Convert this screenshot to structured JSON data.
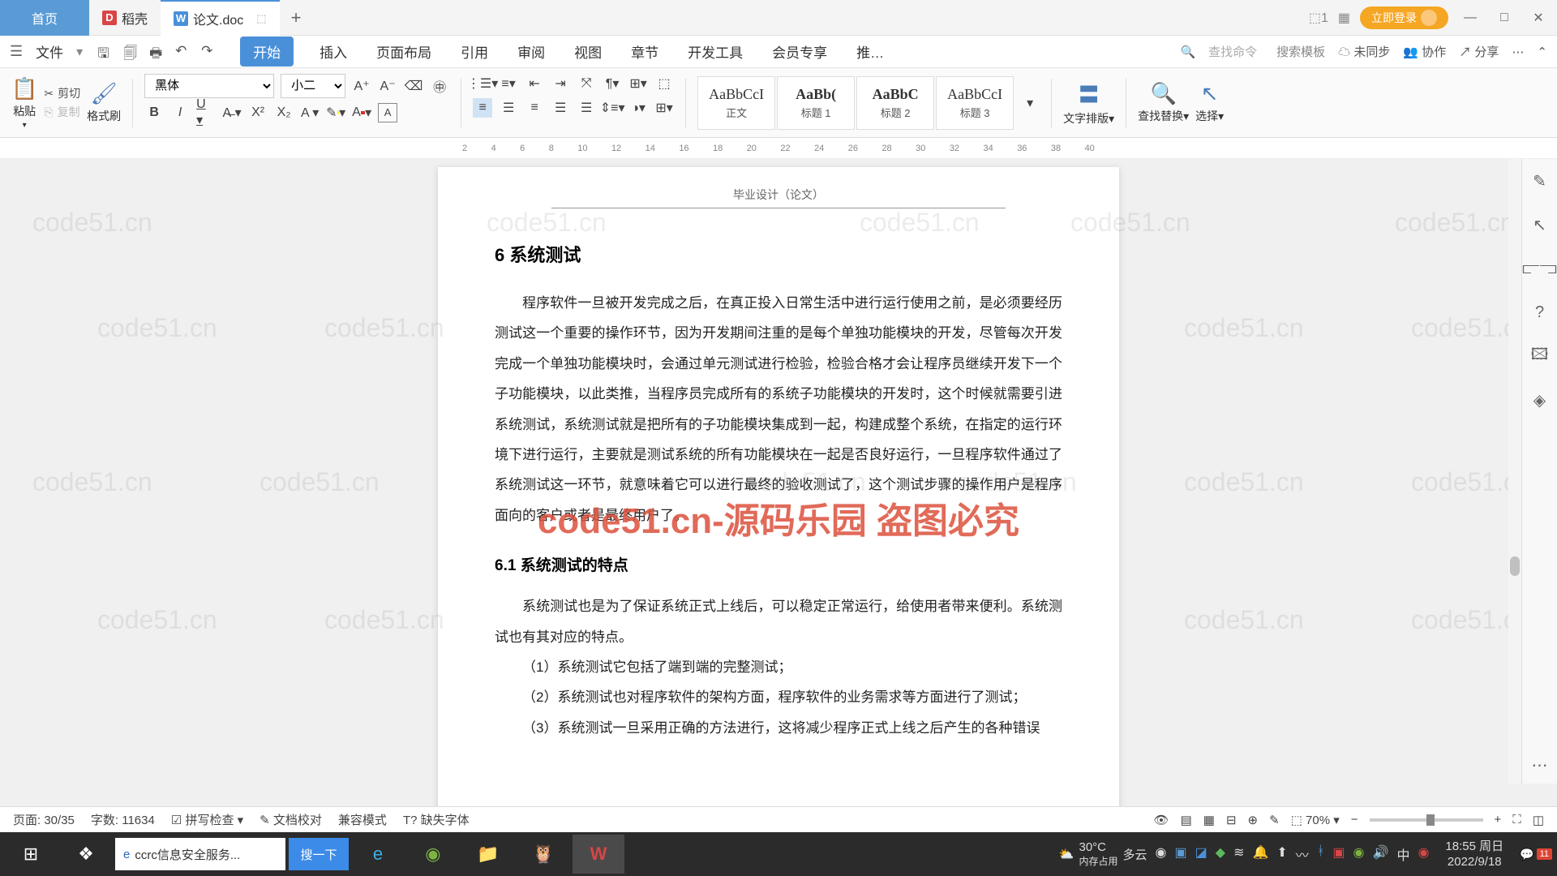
{
  "titlebar": {
    "tabs": [
      {
        "label": "首页",
        "icon": ""
      },
      {
        "label": "稻壳",
        "icon": "D"
      },
      {
        "label": "论文.doc",
        "icon": "W"
      }
    ],
    "login": "立即登录"
  },
  "menubar": {
    "file": "文件",
    "tabs": [
      "开始",
      "插入",
      "页面布局",
      "引用",
      "审阅",
      "视图",
      "章节",
      "开发工具",
      "会员专享",
      "推…"
    ],
    "search_cmd": "查找命令",
    "search_tpl": "搜索模板",
    "right": {
      "unsync": "未同步",
      "collab": "协作",
      "share": "分享"
    }
  },
  "ribbon": {
    "paste": "粘贴",
    "cut": "剪切",
    "copy": "复制",
    "format_painter": "格式刷",
    "font_name": "黑体",
    "font_size": "小二",
    "styles": [
      {
        "prev": "AaBbCcI",
        "label": "正文"
      },
      {
        "prev": "AaBb(",
        "label": "标题 1"
      },
      {
        "prev": "AaBbC",
        "label": "标题 2"
      },
      {
        "prev": "AaBbCcI",
        "label": "标题 3"
      }
    ],
    "text_layout": "文字排版",
    "find_replace": "查找替换",
    "select": "选择"
  },
  "ruler": [
    "2",
    "4",
    "6",
    "8",
    "10",
    "12",
    "14",
    "16",
    "18",
    "20",
    "22",
    "24",
    "26",
    "28",
    "30",
    "32",
    "34",
    "36",
    "38",
    "40"
  ],
  "document": {
    "header": "毕业设计（论文）",
    "h1": "6  系统测试",
    "p1": "程序软件一旦被开发完成之后，在真正投入日常生活中进行运行使用之前，是必须要经历测试这一个重要的操作环节，因为开发期间注重的是每个单独功能模块的开发，尽管每次开发完成一个单独功能模块时，会通过单元测试进行检验，检验合格才会让程序员继续开发下一个子功能模块，以此类推，当程序员完成所有的系统子功能模块的开发时，这个时候就需要引进系统测试，系统测试就是把所有的子功能模块集成到一起，构建成整个系统，在指定的运行环境下进行运行，主要就是测试系统的所有功能模块在一起是否良好运行，一旦程序软件通过了系统测试这一环节，就意味着它可以进行最终的验收测试了，这个测试步骤的操作用户是程序面向的客户或者是最终用户了。",
    "h2": "6.1  系统测试的特点",
    "p2": "系统测试也是为了保证系统正式上线后，可以稳定正常运行，给使用者带来便利。系统测试也有其对应的特点。",
    "li1": "（1）系统测试它包括了端到端的完整测试；",
    "li2": "（2）系统测试也对程序软件的架构方面，程序软件的业务需求等方面进行了测试；",
    "li3": "（3）系统测试一旦采用正确的方法进行，这将减少程序正式上线之后产生的各种错误"
  },
  "watermark_text": "code51.cn",
  "watermark_big": "code51.cn-源码乐园 盗图必究",
  "statusbar": {
    "page": "页面: 30/35",
    "words": "字数: 11634",
    "spellcheck": "拼写检查",
    "proof": "文档校对",
    "compat": "兼容模式",
    "missing_font": "缺失字体",
    "zoom": "70%"
  },
  "taskbar": {
    "app_title": "ccrc信息安全服务...",
    "search_btn": "搜一下",
    "weather": {
      "temp": "30°C",
      "desc": "多云"
    },
    "mem": "内存占用",
    "ime": "中",
    "time": "18:55 周日",
    "date": "2022/9/18",
    "notif": "11"
  }
}
